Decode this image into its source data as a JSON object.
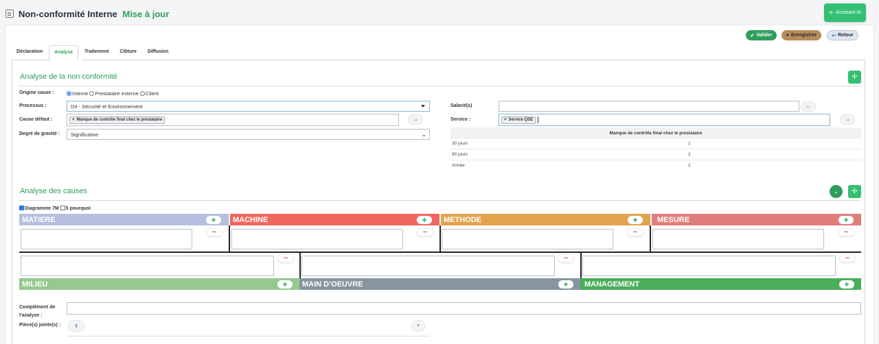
{
  "header": {
    "title": "Non-conformité Interne",
    "subtitle": "Mise à jour",
    "assistant_label": "Assistant IA"
  },
  "actions": {
    "valider": "Valider",
    "enregistrer": "Enregistrer",
    "retour": "Retour"
  },
  "tabs": [
    {
      "label": "Déclaration",
      "active": false
    },
    {
      "label": "Analyse",
      "active": true
    },
    {
      "label": "Traitement",
      "active": false
    },
    {
      "label": "Clôture",
      "active": false
    },
    {
      "label": "Diffusion",
      "active": false
    }
  ],
  "analyse": {
    "title": "Analyse de la non conformité",
    "origine_label": "Origine cause :",
    "origine_options": [
      "Interne",
      "Prestataire externe",
      "Client"
    ],
    "origine_selected": "Interne",
    "processus_label": "Processus :",
    "processus_value": "D4 - Sécurité et Environnement",
    "cause_label": "Cause défaut :",
    "cause_chip": "Manque de contrôle final chez le prestataire",
    "gravite_label": "Degré de gravité :",
    "gravite_value": "Significative",
    "salarie_label": "Salarié(s)",
    "salarie_value": "",
    "service_label": "Service :",
    "service_chip": "Service QSE",
    "table_header": "Manque de contrôle final chez le prestataire",
    "table_rows": [
      {
        "period": "30 jours",
        "value": "1"
      },
      {
        "period": "90 jours",
        "value": "1"
      },
      {
        "period": "Année",
        "value": "1"
      }
    ]
  },
  "causes": {
    "title": "Analyse des causes",
    "option_7m": "Diagramme 7M",
    "option_7m_checked": true,
    "option_5p": "5 pourquoi",
    "option_5p_checked": false,
    "top_categories": [
      {
        "label": "MATIERE",
        "color": "#b6bfdf"
      },
      {
        "label": "MACHINE",
        "color": "#f0675f"
      },
      {
        "label": "METHODE",
        "color": "#e2a34f"
      },
      {
        "label": "MESURE",
        "color": "#e07e7c"
      }
    ],
    "bottom_categories": [
      {
        "label": "MILIEU",
        "color": "#95c98f"
      },
      {
        "label": "MAIN D’OEUVRE",
        "color": "#87959e"
      },
      {
        "label": "MANAGEMENT",
        "color": "#4bae5c"
      }
    ],
    "complement_label_1": "Complément de",
    "complement_label_2": "l'analyse :",
    "complement_value": "",
    "pieces_label": "Pièce(s) jointe(s) :"
  }
}
